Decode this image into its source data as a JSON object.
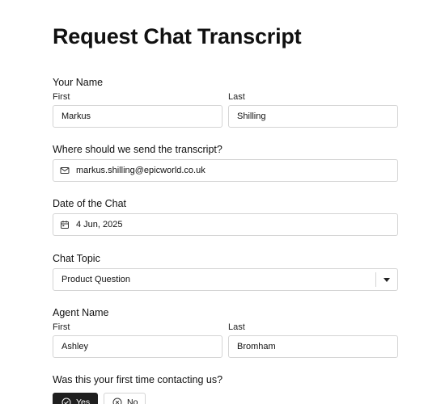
{
  "form": {
    "title": "Request Chat Transcript",
    "name_section": {
      "label": "Your Name",
      "first_label": "First",
      "first_value": "Markus",
      "last_label": "Last",
      "last_value": "Shilling"
    },
    "email_section": {
      "label": "Where should we send the transcript?",
      "icon": "mail-icon",
      "value": "markus.shilling@epicworld.co.uk"
    },
    "date_section": {
      "label": "Date of the Chat",
      "icon": "calendar-icon",
      "value": "4 Jun, 2025"
    },
    "topic_section": {
      "label": "Chat Topic",
      "selected": "Product Question"
    },
    "agent_section": {
      "label": "Agent Name",
      "first_label": "First",
      "first_value": "Ashley",
      "last_label": "Last",
      "last_value": "Bromham"
    },
    "first_time_section": {
      "label": "Was this your first time contacting us?",
      "yes_label": "Yes",
      "no_label": "No",
      "selected": "Yes"
    }
  }
}
